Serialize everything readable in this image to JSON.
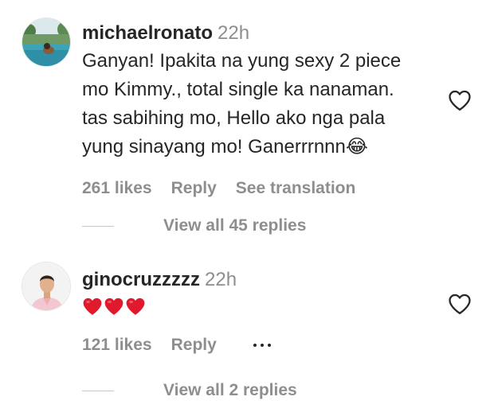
{
  "comments": [
    {
      "username": "michaelronato",
      "time": "22h",
      "text_lines": [
        "Ganyan! Ipakita na yung sexy 2 piece",
        "mo Kimmy., total single ka nanaman.",
        "tas sabihing mo, Hello ako nga pala",
        "yung sinayang mo! Ganerrrnnn😂"
      ],
      "likes": "261 likes",
      "reply_label": "Reply",
      "translate_label": "See translation",
      "view_replies": "View all 45 replies",
      "icon": "heart-outline-icon"
    },
    {
      "username": "ginocruzzzzz",
      "time": "22h",
      "emoji_hearts": 3,
      "likes": "121 likes",
      "reply_label": "Reply",
      "view_replies": "View all 2 replies",
      "icon": "heart-outline-icon"
    }
  ],
  "colors": {
    "primary_text": "#262626",
    "secondary_text": "#8e8e8e",
    "heart_red": "#e0192d"
  }
}
